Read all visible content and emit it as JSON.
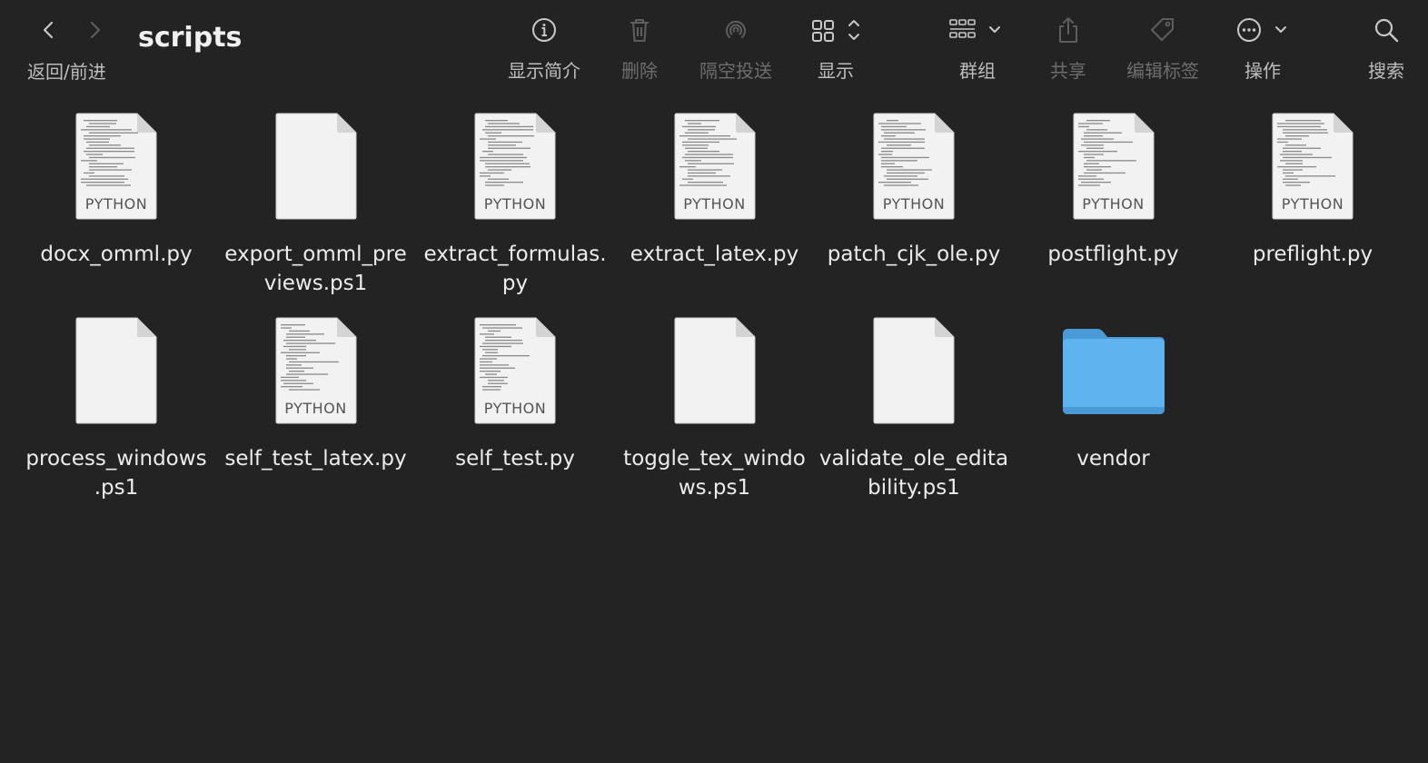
{
  "window": {
    "title": "scripts",
    "nav_label": "返回/前进"
  },
  "toolbar": {
    "get_info": "显示简介",
    "delete": "删除",
    "airdrop": "隔空投送",
    "view": "显示",
    "group": "群组",
    "share": "共享",
    "edit_tags": "编辑标签",
    "action": "操作",
    "search": "搜索"
  },
  "files": [
    {
      "name_line1": "docx_omml.py",
      "name_line2": "",
      "kind": "python",
      "badge": "PYTHON"
    },
    {
      "name_line1": "export_omml_pre",
      "name_line2": "views.ps1",
      "kind": "blank",
      "badge": ""
    },
    {
      "name_line1": "extract_formulas.",
      "name_line2": "py",
      "kind": "python",
      "badge": "PYTHON"
    },
    {
      "name_line1": "extract_latex.py",
      "name_line2": "",
      "kind": "python",
      "badge": "PYTHON"
    },
    {
      "name_line1": "patch_cjk_ole.py",
      "name_line2": "",
      "kind": "python",
      "badge": "PYTHON"
    },
    {
      "name_line1": "postflight.py",
      "name_line2": "",
      "kind": "python",
      "badge": "PYTHON"
    },
    {
      "name_line1": "preflight.py",
      "name_line2": "",
      "kind": "python",
      "badge": "PYTHON"
    },
    {
      "name_line1": "process_windows",
      "name_line2": ".ps1",
      "kind": "blank",
      "badge": ""
    },
    {
      "name_line1": "self_test_latex.py",
      "name_line2": "",
      "kind": "python",
      "badge": "PYTHON"
    },
    {
      "name_line1": "self_test.py",
      "name_line2": "",
      "kind": "python",
      "badge": "PYTHON"
    },
    {
      "name_line1": "toggle_tex_windo",
      "name_line2": "ws.ps1",
      "kind": "blank",
      "badge": ""
    },
    {
      "name_line1": "validate_ole_edita",
      "name_line2": "bility.ps1",
      "kind": "blank",
      "badge": ""
    },
    {
      "name_line1": "vendor",
      "name_line2": "",
      "kind": "folder",
      "badge": ""
    }
  ],
  "colors": {
    "background": "#232323",
    "folder": "#5fb4f0",
    "doc": "#f2f2f2"
  }
}
